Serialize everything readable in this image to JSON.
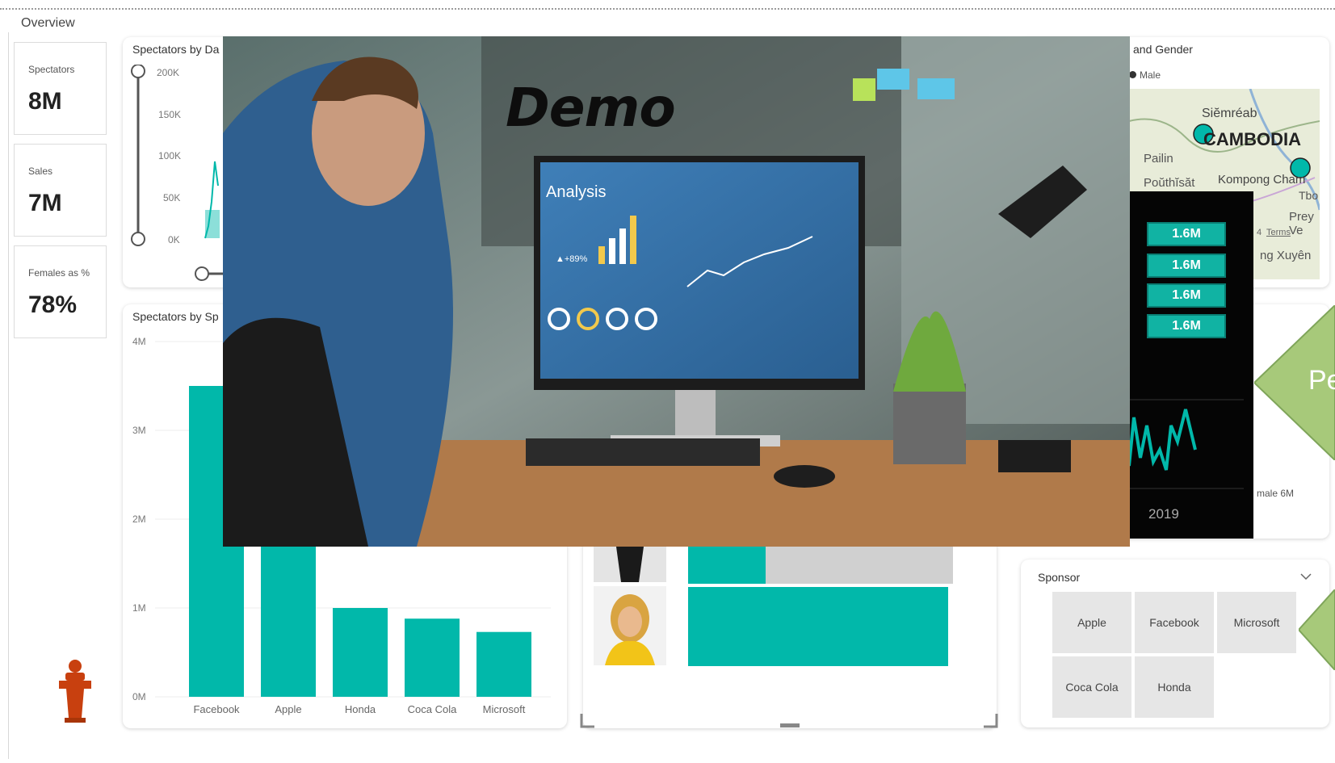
{
  "page": {
    "title": "Overview"
  },
  "kpis": [
    {
      "label": "Spectators",
      "value": "8M"
    },
    {
      "label": "Sales",
      "value": "7M"
    },
    {
      "label": "Females as %",
      "value": "78%"
    }
  ],
  "date_chart": {
    "title": "Spectators by Da",
    "y_ticks": [
      "200K",
      "150K",
      "100K",
      "50K",
      "0K"
    ]
  },
  "sponsor_chart": {
    "title": "Spectators by Sp",
    "y_ticks": [
      "4M",
      "3M",
      "2M",
      "1M",
      "0M"
    ],
    "categories": [
      "Facebook",
      "Apple",
      "Honda",
      "Coca Cola",
      "Microsoft"
    ],
    "values": [
      3.5,
      3.4,
      1.0,
      0.88,
      0.73
    ]
  },
  "map_tile": {
    "title": "and Gender",
    "legend_male": "Male",
    "places": [
      "Siĕmréab",
      "CAMBODIA",
      "Pailin",
      "Poŭthĭsăt",
      "Kompong Cham",
      "Tbo",
      "Prey Ve",
      "ng Xuyên"
    ],
    "terms": "Terms",
    "count": "4"
  },
  "dark_panel": {
    "chips": [
      "1.6M",
      "1.6M",
      "1.6M",
      "1.6M"
    ],
    "year": "2019"
  },
  "right_tile": {
    "caption": "male 6M",
    "arrow_text": "Pe"
  },
  "sponsor_slicer": {
    "title": "Sponsor",
    "options": [
      "Apple",
      "Facebook",
      "Microsoft",
      "Coca Cola",
      "Honda"
    ]
  },
  "overlay": {
    "word": "Demo"
  },
  "monitor": {
    "heading": "Analysis",
    "stat": "▲+89%"
  },
  "colors": {
    "teal": "#01b8aa",
    "grey_bar": "#d0d0d0",
    "accent_green": "#a7c97a"
  }
}
